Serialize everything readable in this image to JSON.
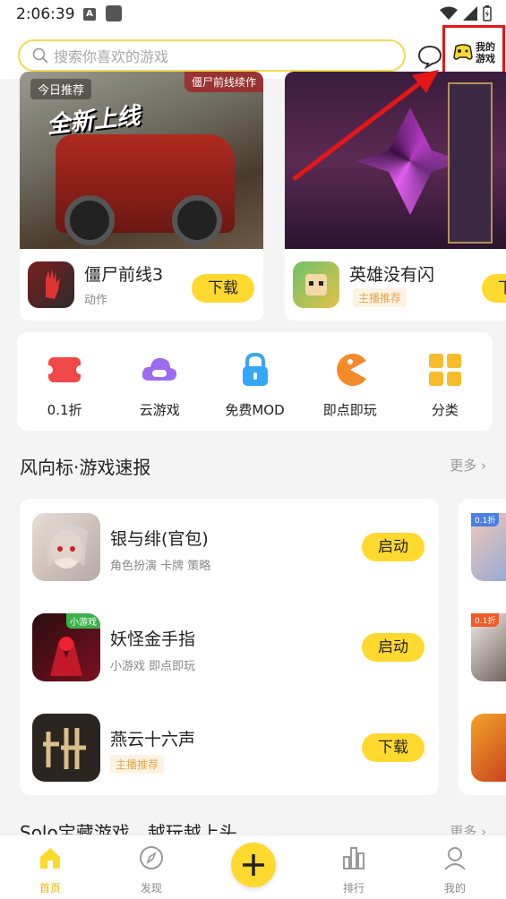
{
  "status_bar": {
    "time": "2:06:39",
    "a_badge": "A"
  },
  "header": {
    "search_placeholder": "搜索你喜欢的游戏",
    "my_games_line1": "我的",
    "my_games_line2": "游戏"
  },
  "featured": [
    {
      "badge": "今日推荐",
      "tag": "僵尸前线续作",
      "headline": "全新上线",
      "name": "僵尸前线3",
      "category": "动作",
      "button": "下载"
    },
    {
      "name": "英雄没有闪",
      "tag": "主播推荐",
      "button": "下载"
    }
  ],
  "categories": [
    {
      "label": "0.1折",
      "icon": "discount-ticket-icon",
      "color": "#f04848"
    },
    {
      "label": "云游戏",
      "icon": "cloud-gamepad-icon",
      "color": "#9b6cf0"
    },
    {
      "label": "免费MOD",
      "icon": "lock-icon",
      "color": "#35a8f5"
    },
    {
      "label": "即点即玩",
      "icon": "pacman-icon",
      "color": "#f58a2a"
    },
    {
      "label": "分类",
      "icon": "grid-icon",
      "color": "#f7bb2c"
    }
  ],
  "section1": {
    "title": "风向标·游戏速报",
    "more": "更多",
    "items": [
      {
        "name": "银与绯(官包)",
        "tags": "角色扮演   卡牌   策略",
        "button": "启动"
      },
      {
        "name": "妖怪金手指",
        "tags": "小游戏   即点即玩",
        "badge": "小游戏",
        "button": "启动"
      },
      {
        "name": "燕云十六声",
        "tag": "主播推荐",
        "button": "下载"
      }
    ],
    "peek_badges": [
      "0.1折",
      "0.1折"
    ]
  },
  "section2": {
    "title": "Solo宝藏游戏，越玩越上头",
    "more": "更多"
  },
  "nav": [
    {
      "label": "首页",
      "active": true
    },
    {
      "label": "发现"
    },
    {
      "label": ""
    },
    {
      "label": "排行"
    },
    {
      "label": "我的"
    }
  ],
  "colors": {
    "accent": "#ffd92e",
    "highlight_box": "#e51616",
    "arrow": "#e51616"
  }
}
